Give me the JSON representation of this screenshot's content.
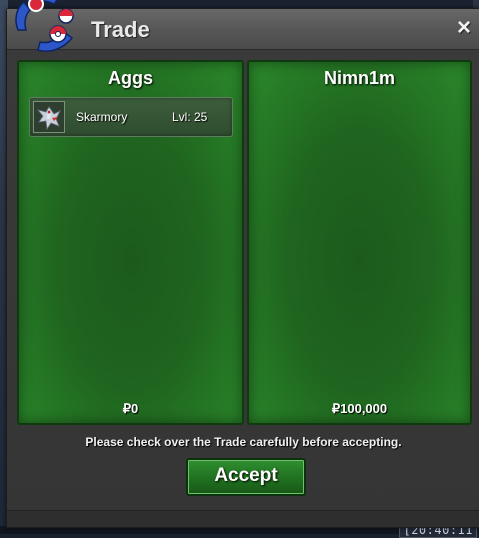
{
  "window": {
    "title": "Trade",
    "close_label": "×"
  },
  "left_panel": {
    "player_name": "Aggs",
    "money": "₽0",
    "items": [
      {
        "name": "Skarmory",
        "level": "Lvl: 25",
        "icon": "skarmory-sprite-icon"
      }
    ]
  },
  "right_panel": {
    "player_name": "Nimn1m",
    "money": "₽100,000",
    "items": []
  },
  "notice": "Please check over the Trade carefully before accepting.",
  "accept_label": "Accept",
  "clock": "[20:40:11",
  "colors": {
    "panel_green": "#1f641f",
    "button_green": "#1f6e1f",
    "logo_blue": "#2d57c8",
    "logo_red": "#d8283a"
  }
}
